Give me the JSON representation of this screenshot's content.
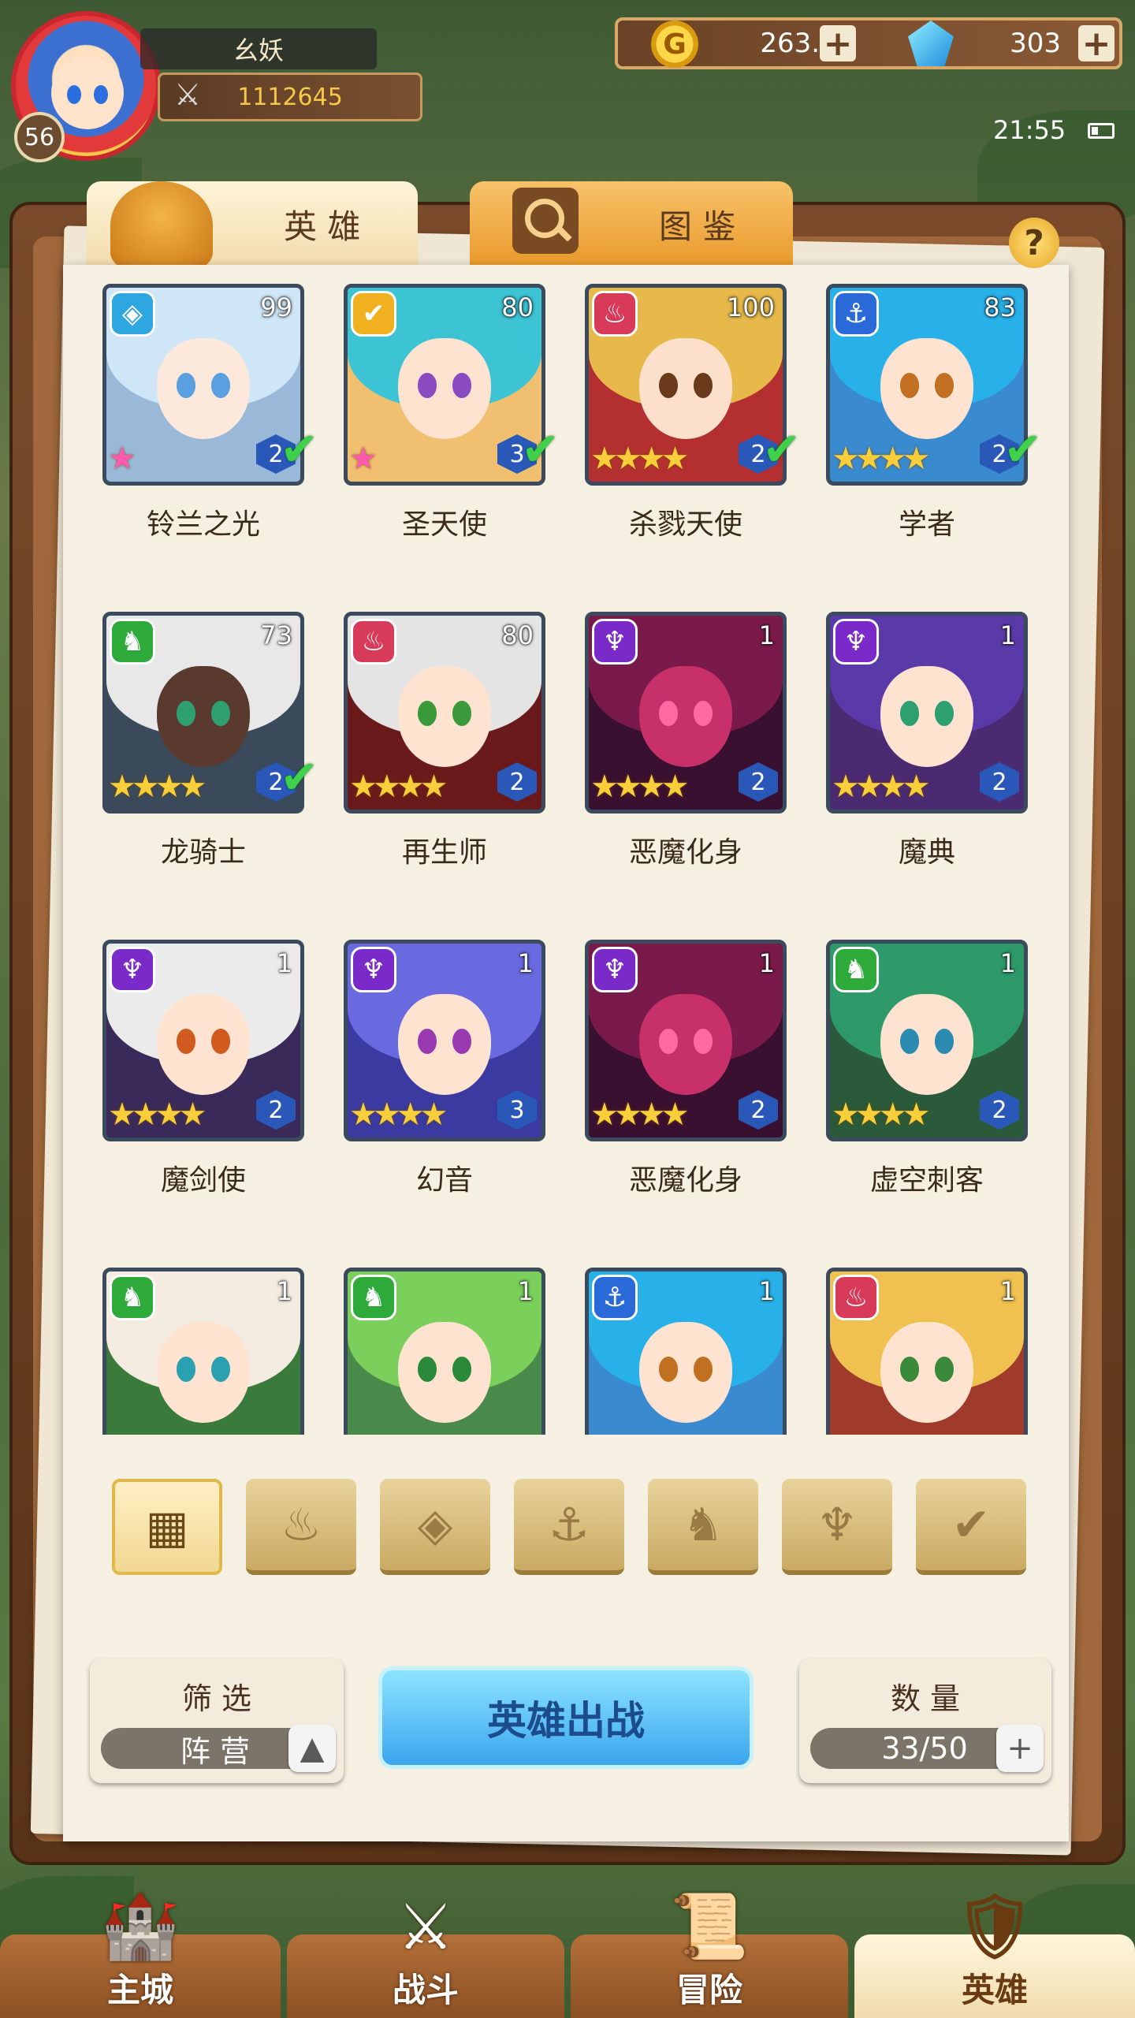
{
  "player": {
    "name": "幺妖",
    "level": "56",
    "power": "1112645"
  },
  "resources": {
    "gold": "263.0K",
    "gems": "303"
  },
  "status": {
    "time": "21:55"
  },
  "tabs": [
    {
      "label": "英 雄",
      "active": true
    },
    {
      "label": "图 鉴",
      "active": false
    }
  ],
  "heroes": [
    {
      "name": "铃兰之光",
      "level": "99",
      "faction": "light-icon",
      "rank": "2",
      "checked": true,
      "stars": "rainbow",
      "hair": "#cfe6f6",
      "skin": "#fde9dc",
      "eye": "#5aa0e0",
      "bg": "#9ab8d8"
    },
    {
      "name": "圣天使",
      "level": "80",
      "faction": "holy-icon",
      "rank": "3",
      "checked": true,
      "stars": "rainbow",
      "hair": "#3cc4d4",
      "skin": "#fde3d0",
      "eye": "#8a4ac0",
      "bg": "#f0c070"
    },
    {
      "name": "杀戮天使",
      "level": "100",
      "faction": "fire-icon",
      "rank": "2",
      "checked": true,
      "stars": "4",
      "hair": "#e7b84a",
      "skin": "#fde0cc",
      "eye": "#6a3a1a",
      "bg": "#b43030"
    },
    {
      "name": "学者",
      "level": "83",
      "faction": "anchor-icon",
      "rank": "2",
      "checked": true,
      "stars": "4",
      "hair": "#28b0e8",
      "skin": "#fde3d0",
      "eye": "#c07020",
      "bg": "#3a8ad0"
    },
    {
      "name": "龙骑士",
      "level": "73",
      "faction": "dragon-icon",
      "rank": "2",
      "checked": true,
      "stars": "4",
      "hair": "#e8e8e8",
      "skin": "#5a3a2e",
      "eye": "#2ea070",
      "bg": "#3a4a5a"
    },
    {
      "name": "再生师",
      "level": "80",
      "faction": "fire-icon",
      "rank": "2",
      "checked": false,
      "stars": "4",
      "hair": "#e4e4e4",
      "skin": "#fde3d0",
      "eye": "#3a9a3a",
      "bg": "#6a1a1a"
    },
    {
      "name": "恶魔化身",
      "level": "1",
      "faction": "demon-icon",
      "rank": "2",
      "checked": false,
      "stars": "4",
      "hair": "#7a1a4a",
      "skin": "#c8306a",
      "eye": "#ff6aa0",
      "bg": "#3a1030"
    },
    {
      "name": "魔典",
      "level": "1",
      "faction": "demon-icon",
      "rank": "2",
      "checked": false,
      "stars": "4",
      "hair": "#5a3aa8",
      "skin": "#fde3d0",
      "eye": "#2ea070",
      "bg": "#4a2a70"
    },
    {
      "name": "魔剑使",
      "level": "1",
      "faction": "demon-icon",
      "rank": "2",
      "checked": false,
      "stars": "4",
      "hair": "#ebebeb",
      "skin": "#fde3d0",
      "eye": "#d05a20",
      "bg": "#3a2a5a"
    },
    {
      "name": "幻音",
      "level": "1",
      "faction": "demon-icon",
      "rank": "3",
      "checked": false,
      "stars": "4",
      "hair": "#6a6ae0",
      "skin": "#fde3d0",
      "eye": "#9a3ab0",
      "bg": "#3a3aa0"
    },
    {
      "name": "恶魔化身",
      "level": "1",
      "faction": "demon-icon",
      "rank": "2",
      "checked": false,
      "stars": "4",
      "hair": "#7a1a4a",
      "skin": "#c8306a",
      "eye": "#ff6aa0",
      "bg": "#3a1030"
    },
    {
      "name": "虚空刺客",
      "level": "1",
      "faction": "dragon-icon",
      "rank": "2",
      "checked": false,
      "stars": "4",
      "hair": "#2e9a6a",
      "skin": "#fde3d0",
      "eye": "#2a8ab0",
      "bg": "#2a5a3a"
    },
    {
      "name": "",
      "level": "1",
      "faction": "dragon-icon",
      "rank": "",
      "checked": false,
      "stars": "",
      "hair": "#f4ece0",
      "skin": "#fde3d0",
      "eye": "#2aa0b0",
      "bg": "#3a7a3a"
    },
    {
      "name": "",
      "level": "1",
      "faction": "dragon-icon",
      "rank": "",
      "checked": false,
      "stars": "",
      "hair": "#7ad05a",
      "skin": "#fde3d0",
      "eye": "#2a8a3a",
      "bg": "#4a8a4a"
    },
    {
      "name": "",
      "level": "1",
      "faction": "anchor-icon",
      "rank": "",
      "checked": false,
      "stars": "",
      "hair": "#28b0e8",
      "skin": "#fde3d0",
      "eye": "#c07020",
      "bg": "#3a8ad0"
    },
    {
      "name": "",
      "level": "1",
      "faction": "fire-icon",
      "rank": "",
      "checked": false,
      "stars": "",
      "hair": "#f0c050",
      "skin": "#fde3d0",
      "eye": "#3a8a3a",
      "bg": "#a03a2a"
    }
  ],
  "filters": [
    {
      "icon": "grid-icon",
      "active": true
    },
    {
      "icon": "fire-faction-icon",
      "active": false
    },
    {
      "icon": "light-faction-icon",
      "active": false
    },
    {
      "icon": "anchor-faction-icon",
      "active": false
    },
    {
      "icon": "dragon-faction-icon",
      "active": false
    },
    {
      "icon": "demon-faction-icon",
      "active": false
    },
    {
      "icon": "holy-faction-icon",
      "active": false
    }
  ],
  "controls": {
    "filter_label": "筛 选",
    "filter_value": "阵 营",
    "deploy_label": "英雄出战",
    "count_label": "数 量",
    "count_value": "33/50"
  },
  "nav": [
    {
      "label": "主城",
      "icon": "castle-icon",
      "active": false
    },
    {
      "label": "战斗",
      "icon": "crossed-swords-icon",
      "active": false
    },
    {
      "label": "冒险",
      "icon": "map-scroll-icon",
      "active": false
    },
    {
      "label": "英雄",
      "icon": "hero-crest-icon",
      "active": true
    }
  ],
  "colors": {
    "fire": "#d83a5a",
    "light": "#2ea6e0",
    "holy": "#f0b020",
    "anchor": "#2a6ad8",
    "dragon": "#2eaa3a",
    "demon": "#7a2ac8"
  }
}
